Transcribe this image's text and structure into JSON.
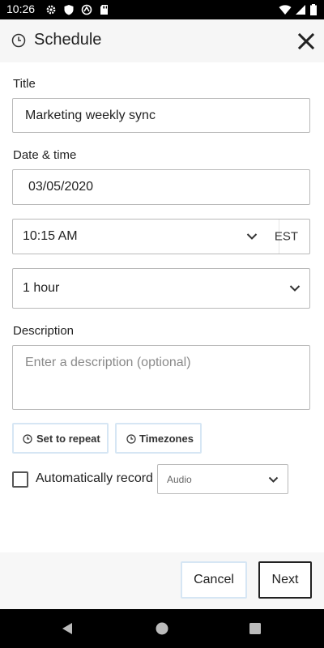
{
  "status_bar": {
    "time": "10:26",
    "icons": [
      "settings-icon",
      "shield-icon",
      "vpn-icon",
      "sd-card-icon",
      "wifi-icon",
      "signal-icon",
      "battery-icon"
    ]
  },
  "header": {
    "title": "Schedule",
    "icon": "clock-icon",
    "close_icon": "close-icon"
  },
  "form": {
    "title_label": "Title",
    "title_value": "Marketing weekly sync",
    "datetime_label": "Date & time",
    "date_value": "03/05/2020",
    "time_value": "10:15 AM",
    "timezone": "EST",
    "duration_value": "1 hour",
    "description_label": "Description",
    "description_placeholder": "Enter a description (optional)",
    "set_repeat_label": "Set to repeat",
    "timezones_label": "Timezones",
    "record_label": "Automatically record",
    "record_checked": false,
    "record_type": "Audio"
  },
  "footer": {
    "cancel_label": "Cancel",
    "next_label": "Next"
  },
  "nav_bar": {
    "icons": [
      "back-icon",
      "home-icon",
      "recents-icon"
    ]
  },
  "colors": {
    "accent_border": "#d6e6f4",
    "header_bg": "#f6f6f6",
    "text": "#222222"
  }
}
